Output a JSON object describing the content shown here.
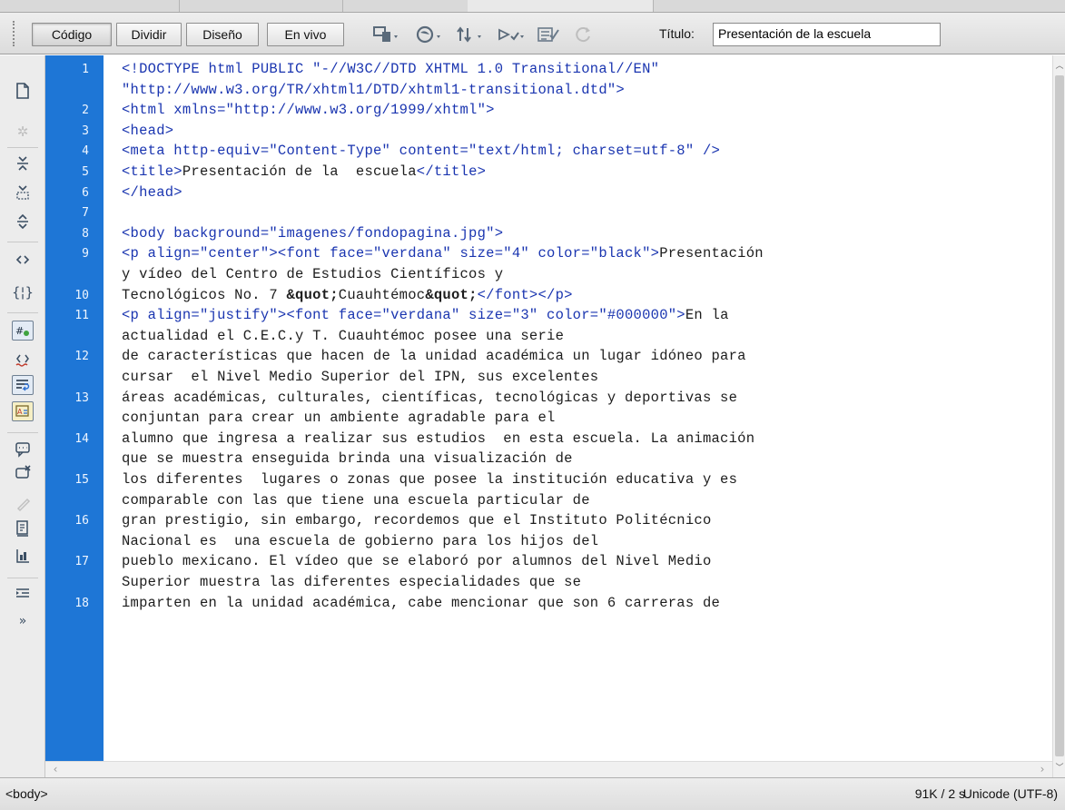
{
  "toolbar": {
    "view_buttons": [
      {
        "label": "Código",
        "active": true
      },
      {
        "label": "Dividir",
        "active": false
      },
      {
        "label": "Diseño",
        "active": false
      },
      {
        "label": "En vivo",
        "active": false
      }
    ],
    "icons": [
      "multiscreen-icon",
      "preview-browser-icon",
      "file-management-icon",
      "check-browser-icon",
      "validate-markup-icon",
      "refresh-icon"
    ],
    "title_label": "Título:",
    "title_value": "Presentación de la escuela"
  },
  "left_toolbar": {
    "icons": [
      "open-documents-icon",
      "show-code-navigator-icon",
      "collapse-full-tag-icon",
      "collapse-selection-icon",
      "expand-all-icon",
      "select-parent-tag-icon",
      "balance-braces-icon",
      "line-numbers-icon",
      "highlight-invalid-code-icon",
      "word-wrap-icon",
      "syntax-coloring-icon",
      "apply-comment-icon",
      "remove-comment-icon",
      "wrap-tag-icon",
      "recent-snippets-icon",
      "move-css-icon",
      "indent-code-icon",
      "more-icon"
    ]
  },
  "editor": {
    "rows": [
      {
        "num": "1",
        "html": "<span class=\"tag\">&lt;!DOCTYPE html PUBLIC \"-//W3C//DTD XHTML 1.0 Transitional//EN\"</span>"
      },
      {
        "num": "",
        "html": "<span class=\"tag\">\"http://www.w3.org/TR/xhtml1/DTD/xhtml1-transitional.dtd\"&gt;</span>"
      },
      {
        "num": "2",
        "html": "<span class=\"tag\">&lt;html xmlns=\"http://www.w3.org/1999/xhtml\"&gt;</span>"
      },
      {
        "num": "3",
        "html": "<span class=\"tag\">&lt;head&gt;</span>"
      },
      {
        "num": "4",
        "html": "<span class=\"tag\">&lt;meta http-equiv=\"Content-Type\" content=\"text/html; charset=utf-8\" /&gt;</span>"
      },
      {
        "num": "5",
        "html": "<span class=\"tag\">&lt;title&gt;</span>Presentación de la  escuela<span class=\"tag\">&lt;/title&gt;</span>"
      },
      {
        "num": "6",
        "html": "<span class=\"tag\">&lt;/head&gt;</span>"
      },
      {
        "num": "7",
        "html": ""
      },
      {
        "num": "8",
        "html": "<span class=\"tag\">&lt;body background=\"imagenes/fondopagina.jpg\"&gt;</span>"
      },
      {
        "num": "9",
        "html": "<span class=\"tag\">&lt;p align=\"center\"&gt;&lt;font face=\"verdana\" size=\"4\" color=\"black\"&gt;</span>Presentación"
      },
      {
        "num": "",
        "html": "y vídeo del Centro de Estudios Científicos y"
      },
      {
        "num": "10",
        "html": "Tecnológicos No. 7 <b>&amp;quot;</b>Cuauhtémoc<b>&amp;quot;</b><span class=\"tag\">&lt;/font&gt;&lt;/p&gt;</span>"
      },
      {
        "num": "11",
        "html": "<span class=\"tag\">&lt;p align=\"justify\"&gt;&lt;font face=\"verdana\" size=\"3\" color=\"#000000\"&gt;</span>En la"
      },
      {
        "num": "",
        "html": "actualidad el C.E.C.y T. Cuauhtémoc posee una serie"
      },
      {
        "num": "12",
        "html": "de características que hacen de la unidad académica un lugar idóneo para"
      },
      {
        "num": "",
        "html": "cursar  el Nivel Medio Superior del IPN, sus excelentes"
      },
      {
        "num": "13",
        "html": "áreas académicas, culturales, científicas, tecnológicas y deportivas se"
      },
      {
        "num": "",
        "html": "conjuntan para crear un ambiente agradable para el"
      },
      {
        "num": "14",
        "html": "alumno que ingresa a realizar sus estudios  en esta escuela. La animación"
      },
      {
        "num": "",
        "html": "que se muestra enseguida brinda una visualización de"
      },
      {
        "num": "15",
        "html": "los diferentes  lugares o zonas que posee la institución educativa y es"
      },
      {
        "num": "",
        "html": "comparable con las que tiene una escuela particular de"
      },
      {
        "num": "16",
        "html": "gran prestigio, sin embargo, recordemos que el Instituto Politécnico"
      },
      {
        "num": "",
        "html": "Nacional es  una escuela de gobierno para los hijos del"
      },
      {
        "num": "17",
        "html": "pueblo mexicano. El vídeo que se elaboró por alumnos del Nivel Medio"
      },
      {
        "num": "",
        "html": "Superior muestra las diferentes especialidades que se"
      },
      {
        "num": "18",
        "html": "imparten en la unidad académica, cabe mencionar que son 6 carreras de"
      }
    ]
  },
  "status": {
    "tag_selector": "<body>",
    "size_time": "91K / 2 s",
    "encoding": "Unicode (UTF-8)"
  },
  "colors": {
    "gutter": "#1e76d6",
    "tag": "#1a35b0"
  }
}
